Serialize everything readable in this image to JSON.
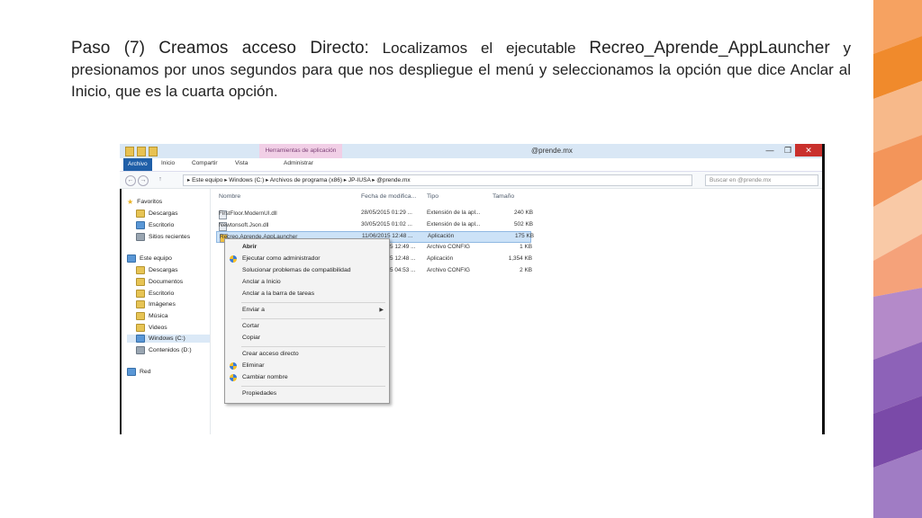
{
  "caption": {
    "step": "Paso (7) Creamos acceso Directo:",
    "text1": "  Localizamos el ejecutable ",
    "exe": "Recreo_Aprende_AppLauncher",
    "text2": " y presionamos por unos segundos para que nos despliegue el menú y  seleccionamos la opción que dice Anclar al Inicio, que es la cuarta opción."
  },
  "window": {
    "title": "@prende.mx",
    "tool_group": "Herramientas de aplicación",
    "ribbon_tabs": [
      "Archivo",
      "Inicio",
      "Compartir",
      "Vista",
      "Administrar"
    ],
    "address": "▸  Este equipo  ▸  Windows (C:)  ▸  Archivos de programa (x86)  ▸  JP-IUSA  ▸  @prende.mx",
    "search_placeholder": "Buscar en @prende.mx",
    "controls": {
      "minimize": "—",
      "maximize": "❐",
      "close": "✕"
    }
  },
  "nav": {
    "favorites": "Favoritos",
    "fav_items": [
      "Descargas",
      "Escritorio",
      "Sitios recientes"
    ],
    "this_pc": "Este equipo",
    "pc_items": [
      "Descargas",
      "Documentos",
      "Escritorio",
      "Imágenes",
      "Música",
      "Videos",
      "Windows (C:)",
      "Contenidos (D:)"
    ],
    "network": "Red"
  },
  "columns": {
    "name": "Nombre",
    "date": "Fecha de modifica...",
    "type": "Tipo",
    "size": "Tamaño"
  },
  "files": [
    {
      "name": "FirstFloor.ModernUI.dll",
      "date": "28/05/2015 01:29 ...",
      "type": "Extensión de la apl...",
      "size": "240 KB"
    },
    {
      "name": "Newtonsoft.Json.dll",
      "date": "30/05/2015 01:02 ...",
      "type": "Extensión de la apl...",
      "size": "502 KB"
    },
    {
      "name": "Recreo.Aprende.AppLauncher",
      "date": "11/06/2015 12:48 ...",
      "type": "Aplicación",
      "size": "175 KB"
    },
    {
      "name": "",
      "date": "5 12:49 ...",
      "type": "Archivo CONFIG",
      "size": "1 KB"
    },
    {
      "name": "",
      "date": "5 12:48 ...",
      "type": "Aplicación",
      "size": "1,354 KB"
    },
    {
      "name": "",
      "date": "5 04:53 ...",
      "type": "Archivo CONFIG",
      "size": "2 KB"
    }
  ],
  "menu": {
    "open": "Abrir",
    "run_admin": "Ejecutar como administrador",
    "troubleshoot": "Solucionar problemas de compatibilidad",
    "pin_start": "Anclar a Inicio",
    "pin_taskbar": "Anclar a la barra de tareas",
    "send_to": "Enviar a",
    "cut": "Cortar",
    "copy": "Copiar",
    "shortcut": "Crear acceso directo",
    "delete": "Eliminar",
    "rename": "Cambiar nombre",
    "properties": "Propiedades"
  },
  "colors": {
    "accent": "#1f5fa8",
    "tool_group": "#f1cfe6",
    "close": "#c9302c",
    "strip_orange": "#f08a2c",
    "strip_purple": "#7a4aa8"
  }
}
